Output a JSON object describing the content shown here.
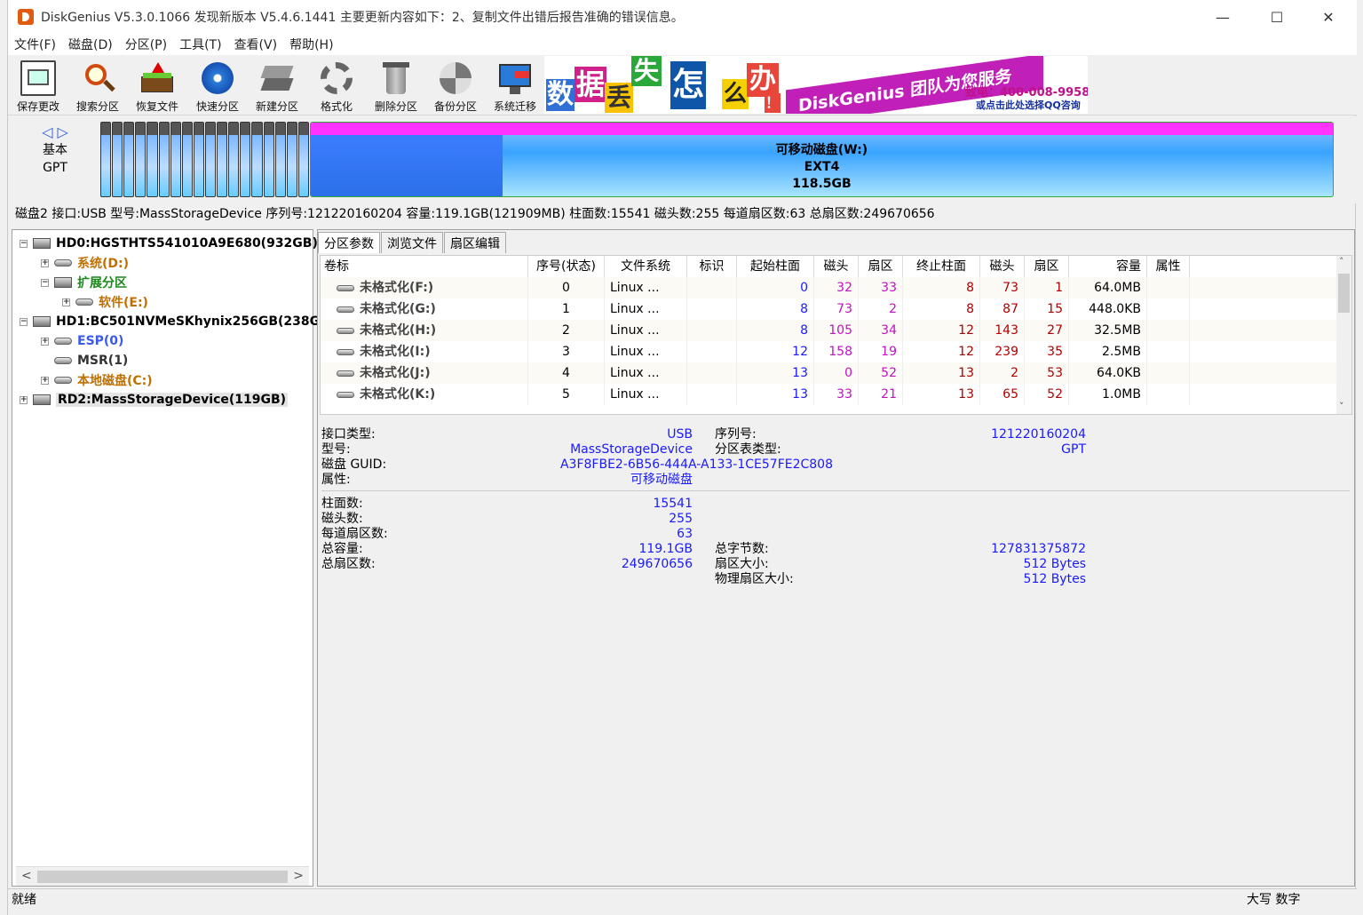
{
  "window": {
    "title": "DiskGenius V5.3.0.1066   发现新版本 V5.4.6.1441 主要更新内容如下：2、复制文件出错后报告准确的错误信息。",
    "minimize": "—",
    "maximize": "☐",
    "close": "✕"
  },
  "menu": [
    "文件(F)",
    "磁盘(D)",
    "分区(P)",
    "工具(T)",
    "查看(V)",
    "帮助(H)"
  ],
  "toolbar": [
    {
      "label": "保存更改",
      "icon": "save-icon"
    },
    {
      "label": "搜索分区",
      "icon": "search-icon"
    },
    {
      "label": "恢复文件",
      "icon": "recover-icon"
    },
    {
      "label": "快速分区",
      "icon": "quick-partition-icon"
    },
    {
      "label": "新建分区",
      "icon": "new-partition-icon"
    },
    {
      "label": "格式化",
      "icon": "format-icon"
    },
    {
      "label": "删除分区",
      "icon": "delete-icon"
    },
    {
      "label": "备份分区",
      "icon": "backup-icon"
    },
    {
      "label": "系统迁移",
      "icon": "migrate-icon"
    }
  ],
  "banner": {
    "chars": [
      "数",
      "据",
      "丢",
      "失",
      "怎",
      "么",
      "办",
      "！"
    ],
    "slogan": "DiskGenius 团队为您服务",
    "phone": "致电：400-008-9958",
    "qq": "或点击此处选择QQ咨询"
  },
  "diskmap": {
    "nav": "◁ ▷",
    "style_line1": "基本",
    "style_line2": "GPT",
    "partition_name": "可移动磁盘(W:)",
    "partition_fs": "EXT4",
    "partition_size": "118.5GB"
  },
  "disk_info": "磁盘2 接口:USB  型号:MassStorageDevice  序列号:121220160204  容量:119.1GB(121909MB)  柱面数:15541  磁头数:255  每道扇区数:63  总扇区数:249670656",
  "tree": {
    "hd0": "HD0:HGSTHTS541010A9E680(932GB)",
    "hd0_sys": "系统(D:)",
    "hd0_ext": "扩展分区",
    "hd0_soft": "软件(E:)",
    "hd1": "HD1:BC501NVMeSKhynix256GB(238G",
    "hd1_esp": "ESP(0)",
    "hd1_msr": "MSR(1)",
    "hd1_local": "本地磁盘(C:)",
    "rd2": "RD2:MassStorageDevice(119GB)"
  },
  "tabs": [
    "分区参数",
    "浏览文件",
    "扇区编辑"
  ],
  "grid": {
    "headers": [
      "卷标",
      "序号(状态)",
      "文件系统",
      "标识",
      "起始柱面",
      "磁头",
      "扇区",
      "终止柱面",
      "磁头",
      "扇区",
      "容量",
      "属性"
    ],
    "rows": [
      [
        "未格式化(F:)",
        "0",
        "Linux ...",
        "",
        "0",
        "32",
        "33",
        "8",
        "73",
        "1",
        "64.0MB",
        ""
      ],
      [
        "未格式化(G:)",
        "1",
        "Linux ...",
        "",
        "8",
        "73",
        "2",
        "8",
        "87",
        "15",
        "448.0KB",
        ""
      ],
      [
        "未格式化(H:)",
        "2",
        "Linux ...",
        "",
        "8",
        "105",
        "34",
        "12",
        "143",
        "27",
        "32.5MB",
        ""
      ],
      [
        "未格式化(I:)",
        "3",
        "Linux ...",
        "",
        "12",
        "158",
        "19",
        "12",
        "239",
        "35",
        "2.5MB",
        ""
      ],
      [
        "未格式化(J:)",
        "4",
        "Linux ...",
        "",
        "13",
        "0",
        "52",
        "13",
        "2",
        "53",
        "64.0KB",
        ""
      ],
      [
        "未格式化(K:)",
        "5",
        "Linux ...",
        "",
        "13",
        "33",
        "21",
        "13",
        "65",
        "52",
        "1.0MB",
        ""
      ]
    ]
  },
  "details": {
    "iface_label": "接口类型:",
    "iface_value": "USB",
    "serial_label": "序列号:",
    "serial_value": "121220160204",
    "model_label": "型号:",
    "model_value": "MassStorageDevice",
    "pt_label": "分区表类型:",
    "pt_value": "GPT",
    "guid_label": "磁盘 GUID:",
    "guid_value": "A3F8FBE2-6B56-444A-A133-1CE57FE2C808",
    "attr_label": "属性:",
    "attr_value": "可移动磁盘",
    "cyl_label": "柱面数:",
    "cyl_value": "15541",
    "heads_label": "磁头数:",
    "heads_value": "255",
    "spt_label": "每道扇区数:",
    "spt_value": "63",
    "cap_label": "总容量:",
    "cap_value": "119.1GB",
    "bytes_label": "总字节数:",
    "bytes_value": "127831375872",
    "sectors_label": "总扇区数:",
    "sectors_value": "249670656",
    "ss_label": "扇区大小:",
    "ss_value": "512 Bytes",
    "pss_label": "物理扇区大小:",
    "pss_value": "512 Bytes"
  },
  "status": {
    "text": "就绪",
    "right": "大写  数字"
  }
}
